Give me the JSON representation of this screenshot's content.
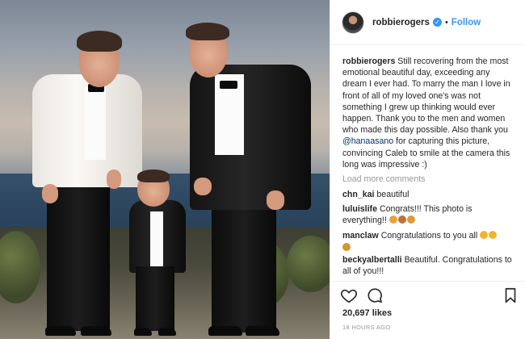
{
  "post": {
    "username": "robbierogers",
    "follow_label": "Follow",
    "separator": "•",
    "caption_user": "robbierogers",
    "caption_text_1": "Still recovering from the most emotional beautiful day, exceeding any dream I ever had. To marry the man I love in front of all of my loved one's was not something I grew up thinking would ever happen. Thank you to the men and women who made this day possible. Also thank you ",
    "caption_mention": "@hanaasano",
    "caption_text_2": " for capturing this picture, convincing Caleb to smile at the camera this long was impressive :)",
    "load_more": "Load more comments",
    "comments": [
      {
        "user": "chn_kai",
        "text": "beautiful"
      },
      {
        "user": "luluislife",
        "text": "Congrats!!! This photo is everything!!"
      },
      {
        "user": "manclaw",
        "text": "Congratulations to you all"
      },
      {
        "user": "beckyalbertalli",
        "text": "Beautiful. Congratulations to all of you!!!"
      }
    ],
    "likes": "20,697 likes",
    "time": "18 HOURS AGO"
  },
  "icons": {
    "verified": "verified-badge-icon",
    "like": "heart-icon",
    "comment": "comment-icon",
    "save": "bookmark-icon"
  },
  "colors": {
    "link": "#3897f0",
    "mention": "#003569",
    "muted": "#999999"
  }
}
